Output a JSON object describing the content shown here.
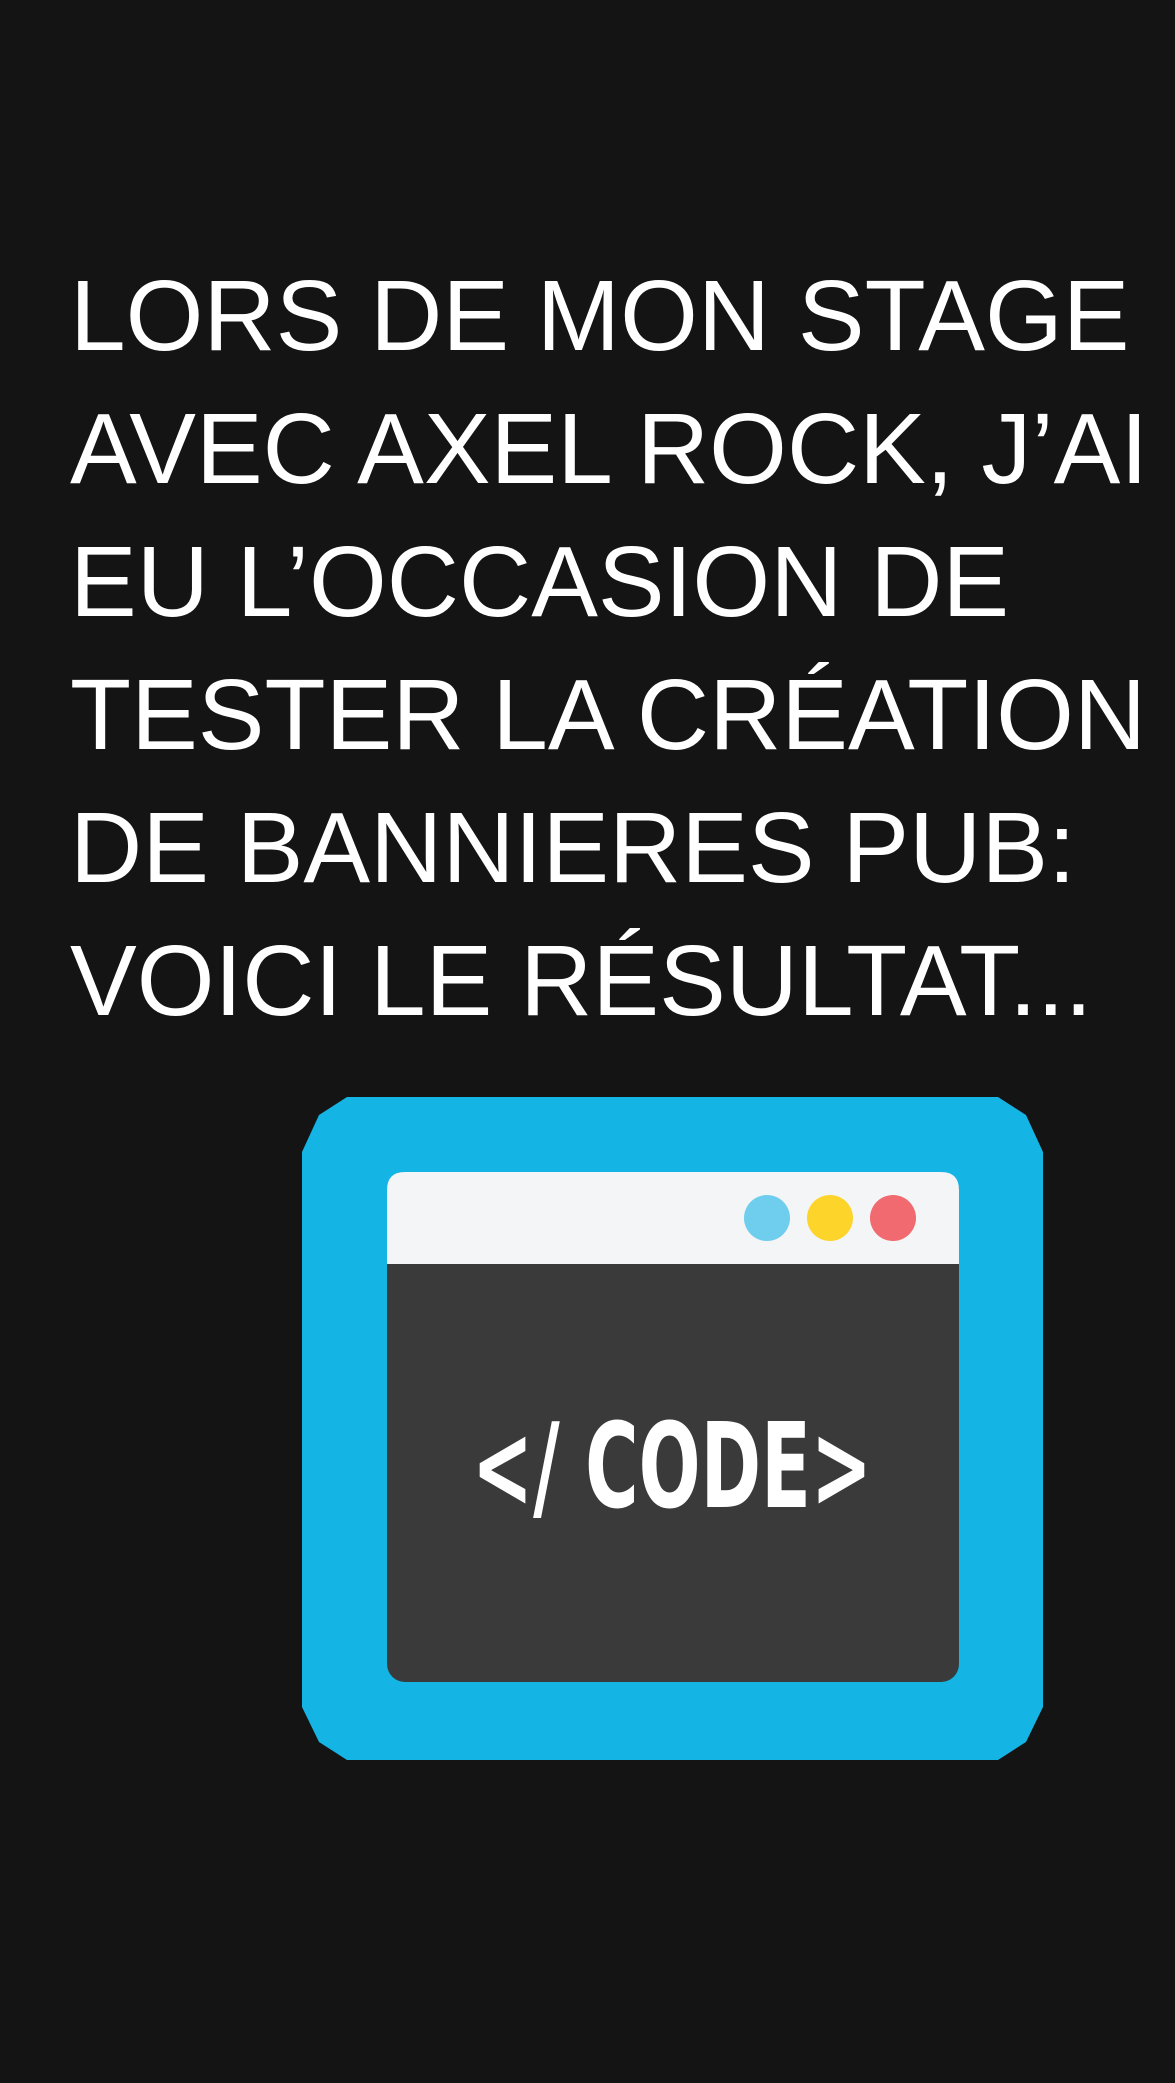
{
  "headline": {
    "lines": [
      "LORS DE MON STAGE",
      "AVEC AXEL ROCK, J’AI",
      "EU L’OCCASION DE",
      "TESTER LA CRÉATION",
      "DE BANNIERES PUB:",
      "VOICI LE RÉSULTAT..."
    ]
  },
  "code_icon": {
    "icon": "code-window-icon",
    "label": "</ CODE>",
    "colors": {
      "frame": "#14b4e5",
      "titlebar": "#f3f5f6",
      "body": "#3a3a3a",
      "dot_blue": "#6fcdee",
      "dot_yellow": "#fdd42a",
      "dot_red": "#f06a6f",
      "label": "#ffffff"
    }
  },
  "colors": {
    "background": "#141414",
    "text": "#ffffff"
  }
}
